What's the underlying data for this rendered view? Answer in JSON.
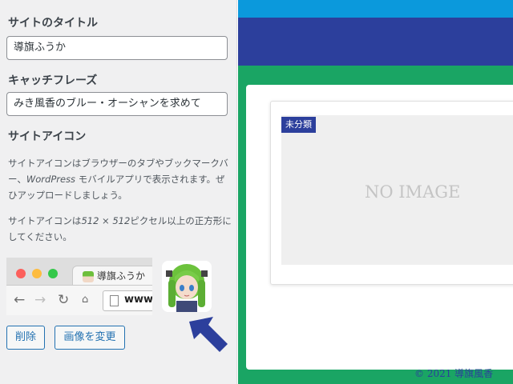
{
  "panel": {
    "site_title": {
      "heading": "サイトのタイトル",
      "value": "導旗ふうか"
    },
    "tagline": {
      "heading": "キャッチフレーズ",
      "value": "みき風香のブルー・オーシャンを求めて"
    },
    "site_icon": {
      "heading": "サイトアイコン",
      "desc1_a": "サイトアイコンはブラウザーのタブやブックマークバー、",
      "desc1_b": "WordPress",
      "desc1_c": " モバイルアプリで表示されます。ぜひアップロードしましょう。",
      "desc2_a": "サイトアイコンは",
      "desc2_b": "512 × 512",
      "desc2_c": "ピクセル以上の正方形にしてください。",
      "preview": {
        "tab_title": "導旗ふうか",
        "url_text": "www.",
        "back_icon": "arrow-left-icon",
        "forward_icon": "arrow-right-icon",
        "reload_icon": "reload-icon",
        "home_icon": "home-icon"
      },
      "remove_label": "削除",
      "change_label": "画像を変更"
    }
  },
  "site": {
    "category_badge": "未分類",
    "no_image_text": "NO IMAGE",
    "footer": "© 2021 導旗風香"
  },
  "colors": {
    "accent_blue": "#2271b1",
    "nav_blue": "#2c3f9c",
    "top_blue": "#0b99dc",
    "site_green": "#1aa564"
  }
}
